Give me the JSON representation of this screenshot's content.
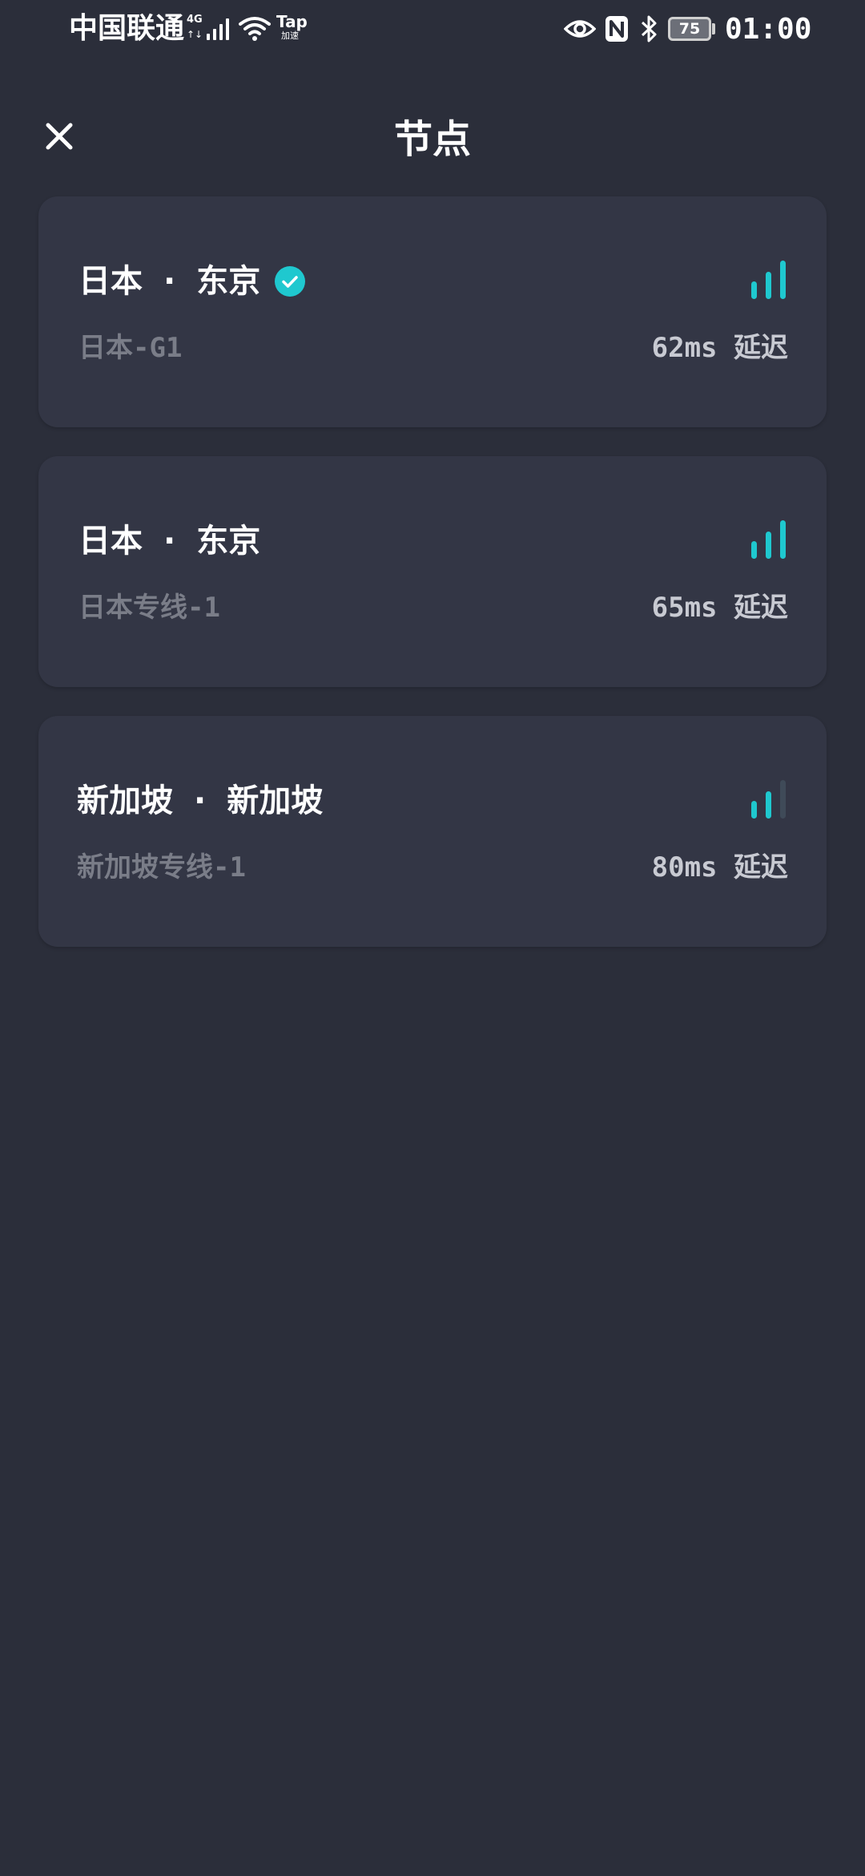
{
  "status_bar": {
    "carrier": "中国联通",
    "network_type": "4G",
    "network_arrows": "↑↓",
    "tap_label": "Tap",
    "tap_sublabel": "加速",
    "battery_level": "75",
    "time": "01:00",
    "icons": [
      "signal-bars-icon",
      "wifi-icon",
      "eye-icon",
      "nfc-icon",
      "bluetooth-icon",
      "battery-icon"
    ]
  },
  "header": {
    "title": "节点",
    "close_icon": "close-icon"
  },
  "colors": {
    "background": "#2b2e3a",
    "card": "#333645",
    "accent": "#1fc8cf",
    "signal_inactive": "#3f4a58",
    "secondary_text": "#7a7d88",
    "latency_text": "#c8cad2"
  },
  "nodes": [
    {
      "country": "日本",
      "separator": "·",
      "city": "东京",
      "line": "日本-G1",
      "latency": "62ms 延迟",
      "selected": true,
      "signal_bars": 3,
      "signal_max": 3
    },
    {
      "country": "日本",
      "separator": "·",
      "city": "东京",
      "line": "日本专线-1",
      "latency": "65ms 延迟",
      "selected": false,
      "signal_bars": 3,
      "signal_max": 3
    },
    {
      "country": "新加坡",
      "separator": "·",
      "city": "新加坡",
      "line": "新加坡专线-1",
      "latency": "80ms 延迟",
      "selected": false,
      "signal_bars": 2,
      "signal_max": 3
    }
  ]
}
